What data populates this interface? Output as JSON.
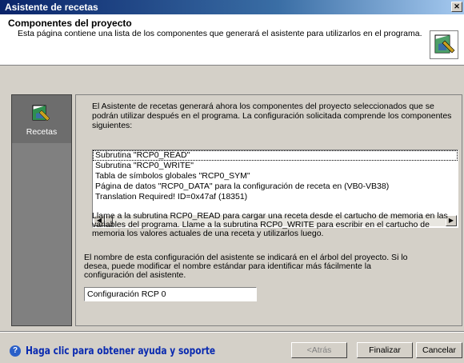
{
  "window": {
    "title": "Asistente de recetas",
    "close_label": "✕"
  },
  "header": {
    "title": "Componentes del proyecto",
    "description": "Esta página contiene una lista de los componentes que generará el asistente para utilizarlos en el programa."
  },
  "sidebar": {
    "items": [
      {
        "label": "Recetas",
        "icon": "recipe-icon"
      }
    ]
  },
  "main": {
    "intro": "El Asistente de recetas generará ahora los componentes del proyecto seleccionados que se podrán utilizar después en el programa. La configuración solicitada comprende los componentes siguientes:",
    "components": [
      "Subrutina \"RCP0_READ\"",
      "Subrutina \"RCP0_WRITE\"",
      "Tabla de símbolos globales \"RCP0_SYM\"",
      "Página de datos \"RCP0_DATA\" para la configuración de receta en (VB0-VB38)",
      "Translation Required! ID=0x47af (18351)"
    ],
    "scroll_left": "◀",
    "scroll_right": "▶",
    "paragraph_calls": "Llame a la subrutina RCP0_READ para cargar una receta desde el cartucho de memoria en las variables del programa. Llame a la subrutina RCP0_WRITE para escribir en el cartucho de memoria los valores actuales de una receta y utilizarlos luego.",
    "paragraph_name": "El nombre de esta configuración del asistente se indicará en el árbol del proyecto. Si lo desea, puede modificar el nombre estándar para identificar más fácilmente la configuración del asistente.",
    "config_name_value": "Configuración RCP 0"
  },
  "footer": {
    "help_text": "Haga clic para obtener ayuda y soporte",
    "back_label": "<Atrás",
    "finish_label": "Finalizar",
    "cancel_label": "Cancelar"
  },
  "colors": {
    "title_bar": "#0a246a",
    "dialog_bg": "#d4d0c8",
    "sidebar_bg": "#808080",
    "help_text": "#0a2ab0"
  }
}
